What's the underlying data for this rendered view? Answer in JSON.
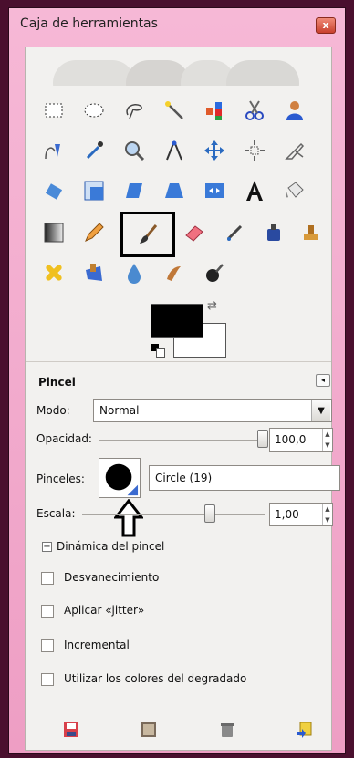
{
  "window": {
    "title": "Caja de herramientas",
    "close_label": "x"
  },
  "tools": [
    {
      "name": "rect-select-icon",
      "selected": false
    },
    {
      "name": "ellipse-select-icon",
      "selected": false
    },
    {
      "name": "free-select-icon",
      "selected": false
    },
    {
      "name": "fuzzy-select-icon",
      "selected": false
    },
    {
      "name": "color-select-icon",
      "selected": false
    },
    {
      "name": "scissors-select-icon",
      "selected": false
    },
    {
      "name": "foreground-select-icon",
      "selected": false
    },
    {
      "name": "paths-icon",
      "selected": false
    },
    {
      "name": "color-picker-icon",
      "selected": false
    },
    {
      "name": "zoom-icon",
      "selected": false
    },
    {
      "name": "measure-icon",
      "selected": false
    },
    {
      "name": "move-icon",
      "selected": false
    },
    {
      "name": "align-icon",
      "selected": false
    },
    {
      "name": "crop-icon",
      "selected": false
    },
    {
      "name": "rotate-icon",
      "selected": false
    },
    {
      "name": "scale-icon",
      "selected": false
    },
    {
      "name": "shear-icon",
      "selected": false
    },
    {
      "name": "perspective-icon",
      "selected": false
    },
    {
      "name": "flip-icon",
      "selected": false
    },
    {
      "name": "text-icon",
      "selected": false
    },
    {
      "name": "bucket-fill-icon",
      "selected": false
    },
    {
      "name": "blend-icon",
      "selected": false
    },
    {
      "name": "pencil-icon",
      "selected": false
    },
    {
      "name": "paintbrush-icon",
      "selected": true
    },
    {
      "name": "eraser-icon",
      "selected": false
    },
    {
      "name": "airbrush-icon",
      "selected": false
    },
    {
      "name": "ink-icon",
      "selected": false
    },
    {
      "name": "clone-icon",
      "selected": false
    },
    {
      "name": "heal-icon",
      "selected": false
    },
    {
      "name": "perspective-clone-icon",
      "selected": false
    },
    {
      "name": "blur-sharpen-icon",
      "selected": false
    },
    {
      "name": "smudge-icon",
      "selected": false
    },
    {
      "name": "dodge-burn-icon",
      "selected": false
    }
  ],
  "colors": {
    "foreground": "#000000",
    "background": "#ffffff"
  },
  "options": {
    "heading": "Pincel",
    "mode_label": "Modo:",
    "mode_value": "Normal",
    "opacity_label": "Opacidad:",
    "opacity_value": "100,0",
    "opacity_level": 1.0,
    "brush_label": "Pinceles:",
    "brush_name": "Circle (19)",
    "scale_label": "Escala:",
    "scale_value": "1,00",
    "dynamics_label": "Dinámica del pincel",
    "checkboxes": [
      {
        "label": "Desvanecimiento",
        "checked": false
      },
      {
        "label": "Aplicar «jitter»",
        "checked": false
      },
      {
        "label": "Incremental",
        "checked": false
      },
      {
        "label": "Utilizar los colores del degradado",
        "checked": false
      }
    ]
  },
  "bottom_buttons": [
    "save-options-icon",
    "restore-options-icon",
    "delete-options-icon",
    "reset-options-icon"
  ]
}
